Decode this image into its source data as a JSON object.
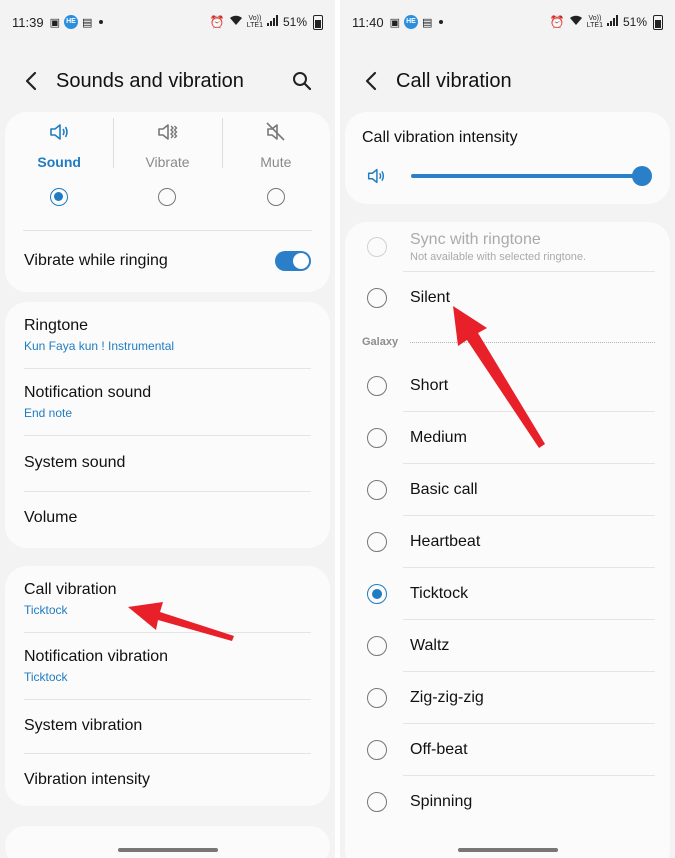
{
  "left": {
    "status": {
      "time": "11:39",
      "badge": "HE",
      "net_top": "Vo))",
      "net_bottom": "LTE1",
      "battery": "51%"
    },
    "header": {
      "title": "Sounds and vibration"
    },
    "sound_mode": {
      "modes": [
        {
          "label": "Sound",
          "icon": "speaker-icon",
          "selected": true
        },
        {
          "label": "Vibrate",
          "icon": "vibrate-icon",
          "selected": false
        },
        {
          "label": "Mute",
          "icon": "mute-icon",
          "selected": false
        }
      ],
      "vibrate_while_ringing": {
        "label": "Vibrate while ringing",
        "on": true
      }
    },
    "sounds": [
      {
        "title": "Ringtone",
        "subtitle": "Kun Faya kun ! Instrumental"
      },
      {
        "title": "Notification sound",
        "subtitle": "End note"
      },
      {
        "title": "System sound"
      },
      {
        "title": "Volume"
      }
    ],
    "vibration": [
      {
        "title": "Call vibration",
        "subtitle": "Ticktock"
      },
      {
        "title": "Notification vibration",
        "subtitle": "Ticktock"
      },
      {
        "title": "System vibration"
      },
      {
        "title": "Vibration intensity"
      }
    ]
  },
  "right": {
    "status": {
      "time": "11:40",
      "badge": "HE",
      "net_top": "Vo))",
      "net_bottom": "LTE1",
      "battery": "51%"
    },
    "header": {
      "title": "Call vibration"
    },
    "intensity": {
      "title": "Call vibration intensity",
      "value_fraction": 1.0
    },
    "patterns": {
      "sync": {
        "label": "Sync with ringtone",
        "subtitle": "Not available with selected ringtone."
      },
      "silent": {
        "label": "Silent"
      },
      "group_label": "Galaxy",
      "items": [
        {
          "label": "Short",
          "selected": false
        },
        {
          "label": "Medium",
          "selected": false
        },
        {
          "label": "Basic call",
          "selected": false
        },
        {
          "label": "Heartbeat",
          "selected": false
        },
        {
          "label": "Ticktock",
          "selected": true
        },
        {
          "label": "Waltz",
          "selected": false
        },
        {
          "label": "Zig-zig-zig",
          "selected": false
        },
        {
          "label": "Off-beat",
          "selected": false
        },
        {
          "label": "Spinning",
          "selected": false
        }
      ]
    }
  },
  "colors": {
    "accent": "#1f7cc2",
    "annotation_arrow": "#e8202a",
    "background": "#f3f3f3",
    "card": "#fbfbfb"
  }
}
